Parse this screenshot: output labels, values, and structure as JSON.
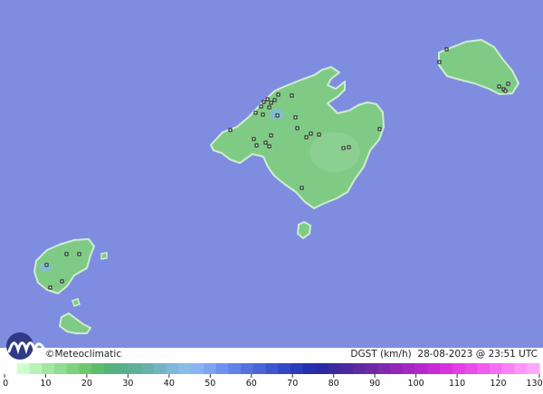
{
  "brand": {
    "copyright": "©",
    "name": "Meteoclimatic"
  },
  "map_info": {
    "variable": "DGST (km/h)",
    "datetime": "28-08-2023 @ 23:51 UTC"
  },
  "colors": {
    "sea": "#7f8de0",
    "land": "#7fcb85",
    "land_dark": "#6cbf76",
    "coast": "#cfeccf",
    "station": "#111111"
  },
  "legend": {
    "ticks": [
      "0",
      "10",
      "20",
      "30",
      "40",
      "50",
      "60",
      "70",
      "80",
      "90",
      "100",
      "110",
      "120",
      "130"
    ],
    "colors": [
      "#ffffff",
      "#ccffcc",
      "#b8f2b8",
      "#a2e6a2",
      "#90dc90",
      "#7fd17f",
      "#6dc86d",
      "#5cbd6f",
      "#54b37a",
      "#58b08a",
      "#5fb09a",
      "#6ab0ad",
      "#74b4c2",
      "#7db8d8",
      "#88bde8",
      "#8ab3f2",
      "#7ea4f2",
      "#6f92ee",
      "#6182e7",
      "#5573e0",
      "#4965d8",
      "#3e56cf",
      "#3448c6",
      "#2b3bbc",
      "#2330b0",
      "#2a2aa3",
      "#3a2a9e",
      "#4c2a9c",
      "#5d2aa0",
      "#6f29a6",
      "#8028ae",
      "#9227b8",
      "#a427c2",
      "#b628cc",
      "#c82bd6",
      "#d832de",
      "#e43ee4",
      "#ec4cea",
      "#f25cef",
      "#f66ef3",
      "#f982f6",
      "#fb95f8",
      "#fda8fa"
    ]
  }
}
